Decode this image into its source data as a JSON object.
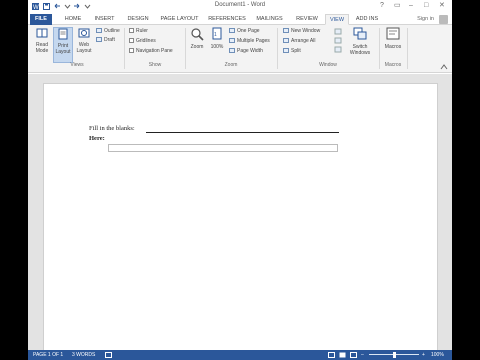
{
  "window": {
    "title": "Document1 - Word",
    "controls": [
      "?",
      "▭",
      "–",
      "□",
      "✕"
    ]
  },
  "tabs": [
    {
      "label": "FILE"
    },
    {
      "label": "HOME"
    },
    {
      "label": "INSERT"
    },
    {
      "label": "DESIGN"
    },
    {
      "label": "PAGE LAYOUT"
    },
    {
      "label": "REFERENCES"
    },
    {
      "label": "MAILINGS"
    },
    {
      "label": "REVIEW"
    },
    {
      "label": "VIEW"
    },
    {
      "label": "ADD INS"
    }
  ],
  "account": {
    "signin_label": "Sign in"
  },
  "ribbon": {
    "views": {
      "read_mode": "Read Mode",
      "print_layout": "Print Layout",
      "web_layout": "Web Layout",
      "outline": "Outline",
      "draft": "Draft",
      "label": "Views"
    },
    "show": {
      "ruler": "Ruler",
      "gridlines": "Gridlines",
      "navigation_pane": "Navigation Pane",
      "label": "Show"
    },
    "zoom": {
      "zoom": "Zoom",
      "percent": "100%",
      "one_page": "One Page",
      "multiple_pages": "Multiple Pages",
      "page_width": "Page Width",
      "label": "Zoom"
    },
    "window": {
      "new_window": "New Window",
      "arrange_all": "Arrange All",
      "split": "Split",
      "switch_windows": "Switch Windows",
      "label": "Window"
    },
    "macros": {
      "macros": "Macros",
      "label": "Macros"
    }
  },
  "document": {
    "line1": "Fill in the blanks:",
    "line2": "Here:"
  },
  "status": {
    "page": "PAGE 1 OF 1",
    "words": "3 WORDS",
    "zoom_percent": "100%",
    "zoom_level": 0.5
  },
  "colors": {
    "accent": "#2b579a",
    "ribbon_bg": "#f3f3f3"
  }
}
